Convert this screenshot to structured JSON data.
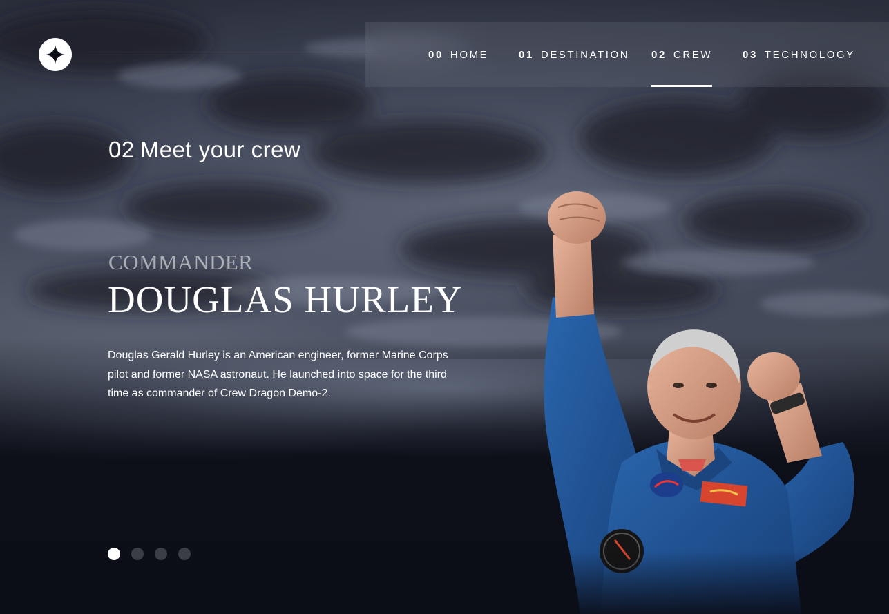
{
  "nav": {
    "items": [
      {
        "num": "00",
        "label": "HOME"
      },
      {
        "num": "01",
        "label": "DESTINATION"
      },
      {
        "num": "02",
        "label": "CREW"
      },
      {
        "num": "03",
        "label": "TECHNOLOGY"
      }
    ],
    "active_index": 2
  },
  "section": {
    "num": "02",
    "title": "Meet your crew"
  },
  "crew": {
    "role": "COMMANDER",
    "name": "DOUGLAS HURLEY",
    "bio": "Douglas Gerald Hurley is an American engineer, former Marine Corps pilot and former NASA astronaut. He launched into space for the third time as commander of Crew Dragon Demo-2.",
    "dots_count": 4,
    "active_dot": 0
  },
  "icons": {
    "logo": "star-logo-icon"
  },
  "colors": {
    "background": "#0b0d17",
    "text": "#ffffff",
    "muted": "#8b8d96",
    "suit": "#1d4f8f"
  }
}
